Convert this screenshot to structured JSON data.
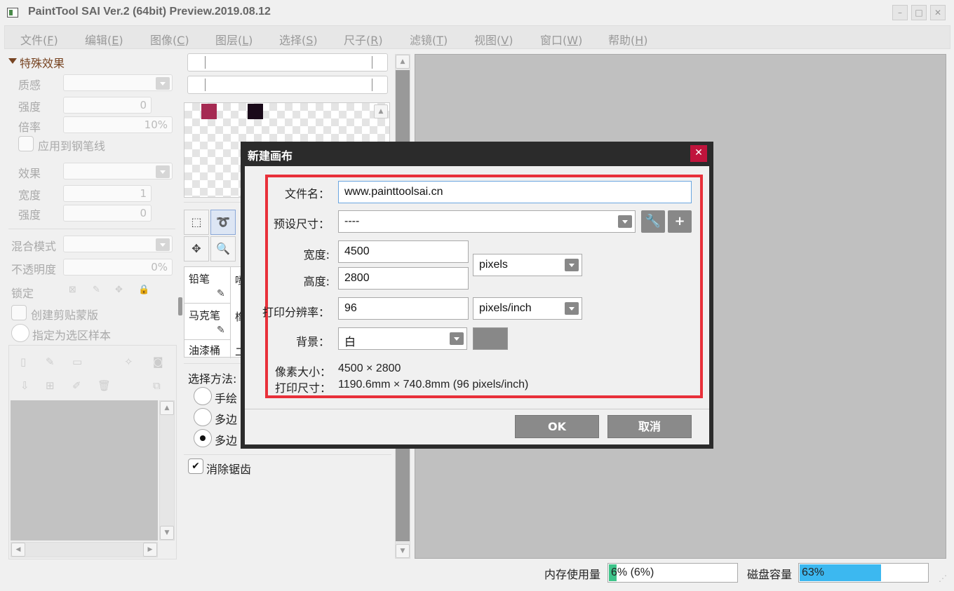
{
  "window": {
    "title": "PaintTool SAI Ver.2 (64bit) Preview.2019.08.12",
    "min": "–",
    "max": "□",
    "close": "✕"
  },
  "menu": [
    {
      "label": "文件(",
      "key": "F",
      "end": ")"
    },
    {
      "label": "编辑(",
      "key": "E",
      "end": ")"
    },
    {
      "label": "图像(",
      "key": "C",
      "end": ")"
    },
    {
      "label": "图层(",
      "key": "L",
      "end": ")"
    },
    {
      "label": "选择(",
      "key": "S",
      "end": ")"
    },
    {
      "label": "尺子(",
      "key": "R",
      "end": ")"
    },
    {
      "label": "滤镜(",
      "key": "T",
      "end": ")"
    },
    {
      "label": "视图(",
      "key": "V",
      "end": ")"
    },
    {
      "label": "窗口(",
      "key": "W",
      "end": ")"
    },
    {
      "label": "帮助(",
      "key": "H",
      "end": ")"
    }
  ],
  "left": {
    "section": "特殊效果",
    "texture": "质感",
    "strength1": "强度",
    "strength1_val": "0",
    "rate": "倍率",
    "rate_val": "10%",
    "apply_pen": "应用到钢笔线",
    "effect": "效果",
    "width": "宽度",
    "width_val": "1",
    "strength2": "强度",
    "strength2_val": "0",
    "blend": "混合模式",
    "opacity": "不透明度",
    "opacity_val": "0%",
    "lock": "锁定",
    "clip": "创建剪贴蒙版",
    "sample": "指定为选区样本"
  },
  "mid": {
    "swatch1": "#a52a52",
    "swatch2": "#1a0a1a",
    "brushes": [
      {
        "name": "铅笔"
      },
      {
        "name": "马克笔"
      },
      {
        "name": "油漆桶"
      }
    ],
    "brush_col2": [
      "喷",
      "橡",
      "二"
    ],
    "select_method": "选择方法:",
    "methods": [
      "手绘",
      "多边",
      "多边"
    ],
    "antialias": "消除锯齿"
  },
  "dialog": {
    "title": "新建画布",
    "filename_label": "文件名：",
    "filename": "www.painttoolsai.cn",
    "preset_label": "预设尺寸：",
    "preset": "----",
    "width_label": "宽度:",
    "width": "4500",
    "height_label": "高度:",
    "height": "2800",
    "unit": "pixels",
    "dpi_label": "打印分辨率：",
    "dpi": "96",
    "dpi_unit": "pixels/inch",
    "bg_label": "背景：",
    "bg": "白",
    "bg_color": "#888888",
    "pixel_size_label": "像素大小：",
    "pixel_size": "4500 × 2800",
    "print_size_label": "打印尺寸：",
    "print_size": "1190.6mm × 740.8mm (96 pixels/inch)",
    "ok": "OK",
    "cancel": "取消"
  },
  "status": {
    "mem_label": "内存使用量",
    "mem": "6% (6%)",
    "mem_pct": 6,
    "disk_label": "磁盘容量",
    "disk": "63%",
    "disk_pct": 63
  }
}
